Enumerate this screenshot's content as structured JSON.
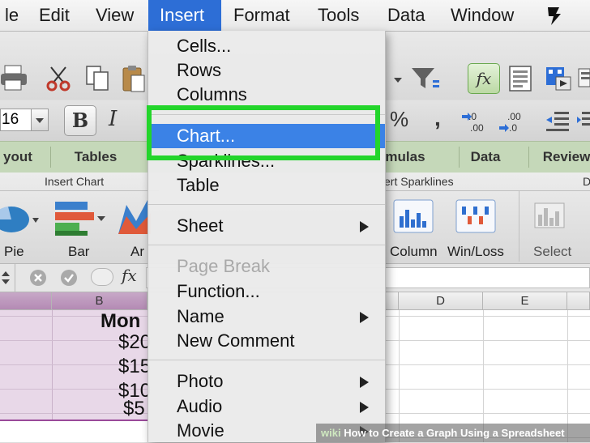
{
  "menubar": {
    "items": [
      "le",
      "Edit",
      "View",
      "Insert",
      "Format",
      "Tools",
      "Data",
      "Window"
    ],
    "active_index": 3,
    "active_color": "#2d6ed6"
  },
  "toolbar": {
    "font_size_value": "16",
    "bold_label": "B",
    "italic_label": "I",
    "percent_label": "%",
    "comma_label": ",",
    "fx_label": "fx",
    "increase_decimal_label": ".0\n.00",
    "decrease_decimal_label": ".00\n.0"
  },
  "ribbon_tabs": [
    "yout",
    "Tables",
    "mulas",
    "Data",
    "Review"
  ],
  "ribbon": {
    "group_insert_chart": "Insert Chart",
    "group_insert_sparklines": "ert Sparklines",
    "group_right_cut": "D",
    "buttons": {
      "pie": "Pie",
      "bar": "Bar",
      "area": "Ar",
      "column": "Column",
      "win_loss": "Win/Loss",
      "select": "Select"
    }
  },
  "formula_bar": {
    "fx_label": "fx"
  },
  "grid": {
    "column_headers": [
      "B",
      "D",
      "E"
    ],
    "header_cell": "Mon",
    "values": [
      "$20",
      "$15",
      "$10",
      "$5"
    ],
    "row_highlight_color": "#e7d6e7"
  },
  "dropdown": {
    "items": [
      {
        "label": "Cells...",
        "disabled": false,
        "submenu": false
      },
      {
        "label": "Rows",
        "disabled": false,
        "submenu": false
      },
      {
        "label": "Columns",
        "disabled": false,
        "submenu": false
      },
      {
        "label": "Chart...",
        "disabled": false,
        "submenu": false,
        "highlighted": true
      },
      {
        "label": "Sparklines...",
        "disabled": false,
        "submenu": false
      },
      {
        "label": "Table",
        "disabled": false,
        "submenu": false
      },
      {
        "label": "Sheet",
        "disabled": false,
        "submenu": true
      },
      {
        "label": "Page Break",
        "disabled": true,
        "submenu": false
      },
      {
        "label": "Function...",
        "disabled": false,
        "submenu": false
      },
      {
        "label": "Name",
        "disabled": false,
        "submenu": true
      },
      {
        "label": "New Comment",
        "disabled": false,
        "submenu": false
      },
      {
        "label": "Photo",
        "disabled": false,
        "submenu": true
      },
      {
        "label": "Audio",
        "disabled": false,
        "submenu": true
      },
      {
        "label": "Movie",
        "disabled": false,
        "submenu": true
      }
    ],
    "highlight_color": "#3b82e6",
    "annotation_color": "#23d52b"
  },
  "watermark": {
    "brand": "wiki",
    "text": "How to Create a Graph Using a Spreadsheet"
  }
}
